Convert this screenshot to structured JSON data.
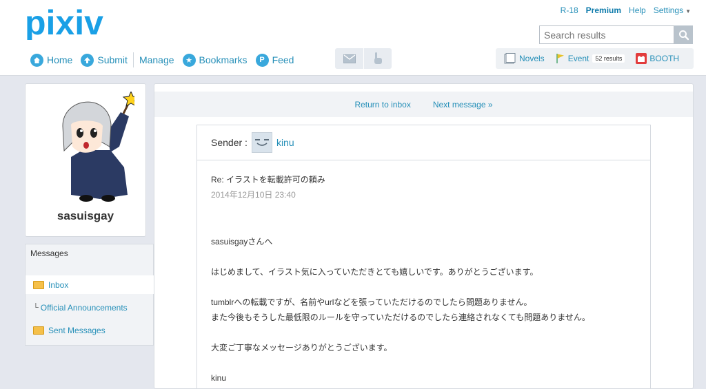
{
  "logo": {
    "text": "pixiv"
  },
  "top_links": [
    {
      "label": "R-18"
    },
    {
      "label": "Premium"
    },
    {
      "label": "Help"
    },
    {
      "label": "Settings"
    }
  ],
  "search": {
    "placeholder": "Search results",
    "icon": "magnifier-icon"
  },
  "nav": [
    {
      "label": "Home",
      "icon": "home-icon"
    },
    {
      "label": "Submit",
      "icon": "upload-icon"
    },
    {
      "label": "Manage"
    },
    {
      "label": "Bookmarks",
      "icon": "star-icon"
    },
    {
      "label": "Feed",
      "icon": "feed-icon"
    }
  ],
  "icon_buttons": [
    "mail-icon",
    "hand-icon"
  ],
  "right_nav": {
    "novels": "Novels",
    "event": "Event",
    "event_badge": "52 results",
    "booth": "BOOTH"
  },
  "profile": {
    "username": "sasuisgay"
  },
  "messages_panel": {
    "title": "Messages",
    "inbox": "Inbox",
    "official": "Official Announcements",
    "sent": "Sent Messages"
  },
  "message_nav": {
    "return": "Return to inbox",
    "next": "Next message »"
  },
  "message": {
    "sender_label": "Sender :",
    "sender_name": "kinu",
    "subject": "Re: イラストを転載許可の頼み",
    "date": "2014年12月10日 23:40",
    "body": [
      "sasuisgayさんへ",
      "",
      "はじめまして、イラスト気に入っていただきとても嬉しいです。ありがとうございます。",
      "",
      "tumblrへの転載ですが、名前やurlなどを張っていただけるのでしたら問題ありません。",
      "また今後もそうした最低限のルールを守っていただけるのでしたら連絡されなくても問題ありません。",
      "",
      "大変ご丁寧なメッセージありがとうございます。",
      "",
      "kinu"
    ]
  },
  "colors": {
    "link": "#258fb8",
    "brand": "#0096fa",
    "background": "#e4e7ee"
  }
}
